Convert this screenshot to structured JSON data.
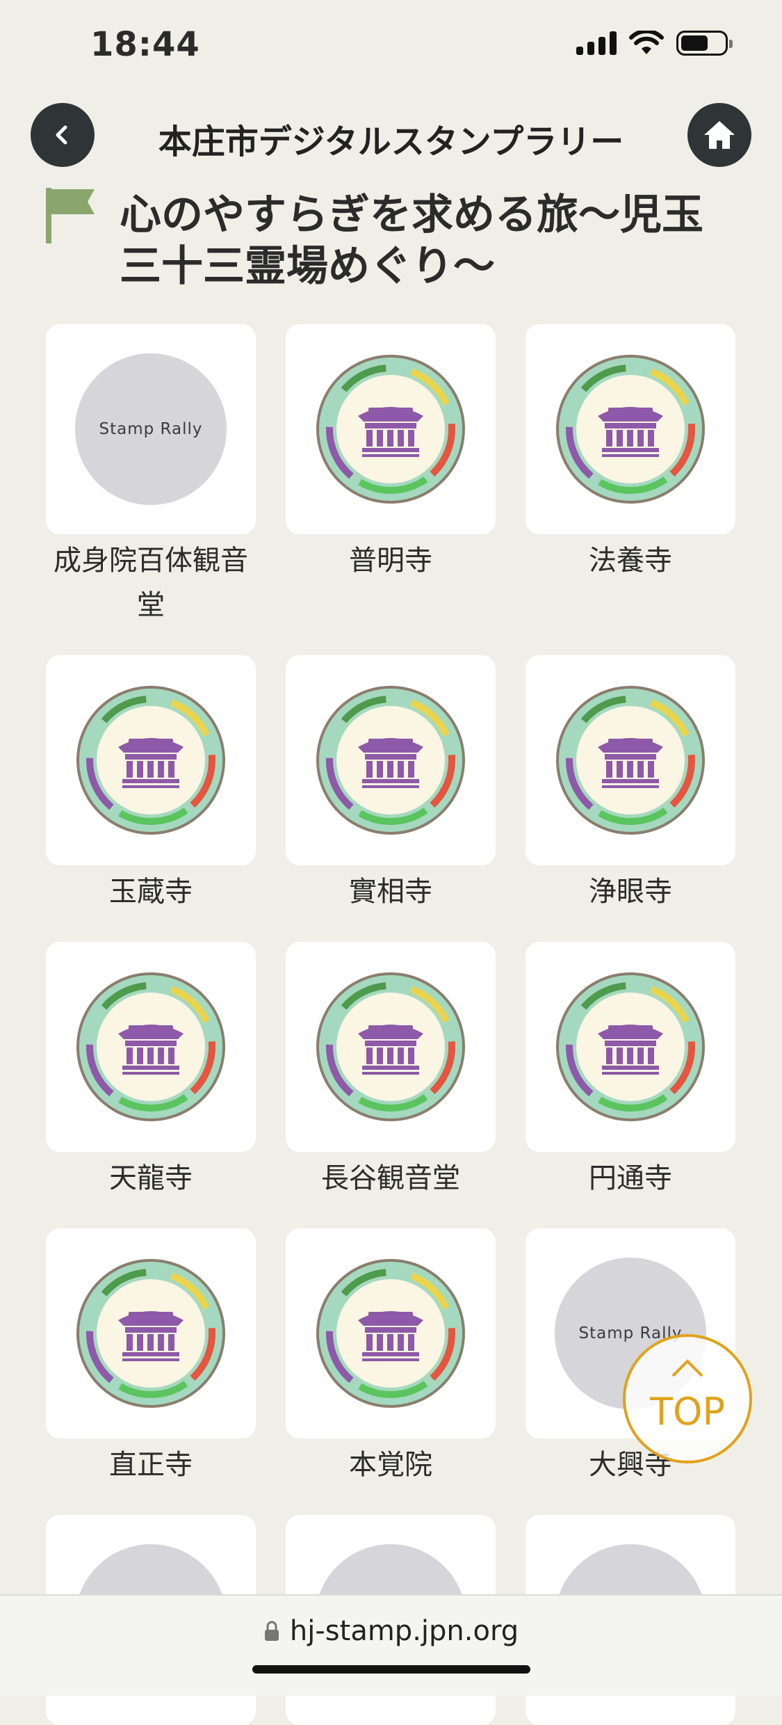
{
  "status": {
    "time": "18:44"
  },
  "header": {
    "title": "本庄市デジタルスタンプラリー"
  },
  "page": {
    "title_line1": "心のやすらぎを求める旅〜児玉",
    "title_line2": "三十三霊場めぐり〜"
  },
  "placeholder_text": "Stamp Rally",
  "spots": [
    {
      "name": "成身院百体観音",
      "name2": "堂",
      "stamped": false
    },
    {
      "name": "普明寺",
      "stamped": true
    },
    {
      "name": "法養寺",
      "stamped": true
    },
    {
      "name": "玉蔵寺",
      "stamped": true
    },
    {
      "name": "實相寺",
      "stamped": true
    },
    {
      "name": "浄眼寺",
      "stamped": true
    },
    {
      "name": "天龍寺",
      "stamped": true
    },
    {
      "name": "長谷観音堂",
      "stamped": true
    },
    {
      "name": "円通寺",
      "stamped": true
    },
    {
      "name": "直正寺",
      "stamped": true
    },
    {
      "name": "本覚院",
      "stamped": true
    },
    {
      "name": "大興寺",
      "stamped": false
    }
  ],
  "top_button": {
    "label": "TOP"
  },
  "browser": {
    "url": "hj-stamp.jpn.org"
  },
  "colors": {
    "accent": "#e0a21c",
    "temple": "#8d59a8",
    "flag": "#8aa66e"
  }
}
